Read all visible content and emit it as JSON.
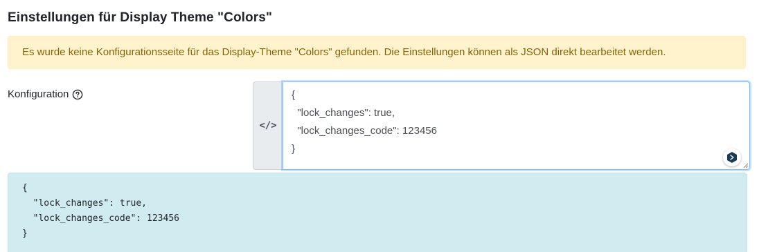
{
  "page": {
    "title": "Einstellungen für Display Theme \"Colors\""
  },
  "warning": {
    "text": "Es wurde keine Konfigurationsseite für das Display-Theme \"Colors\" gefunden. Die Einstellungen können als JSON direkt bearbeitet werden."
  },
  "config": {
    "label": "Konfiguration",
    "help_icon": "question-circle-icon",
    "prepend_icon_text": "</>",
    "editor_lines": [
      "{",
      "  \"lock_changes\": true,",
      "  \"lock_changes_code\": 123456",
      "}"
    ],
    "extension_icon": "browser-extension-icon"
  },
  "preview": {
    "lines": [
      "{",
      "  \"lock_changes\": true,",
      "  \"lock_changes_code\": 123456",
      "}"
    ]
  },
  "colors": {
    "warning_bg": "#fff3cd",
    "warning_text": "#856404",
    "info_bg": "#d1ecf1",
    "focus_border": "#80bdff"
  }
}
